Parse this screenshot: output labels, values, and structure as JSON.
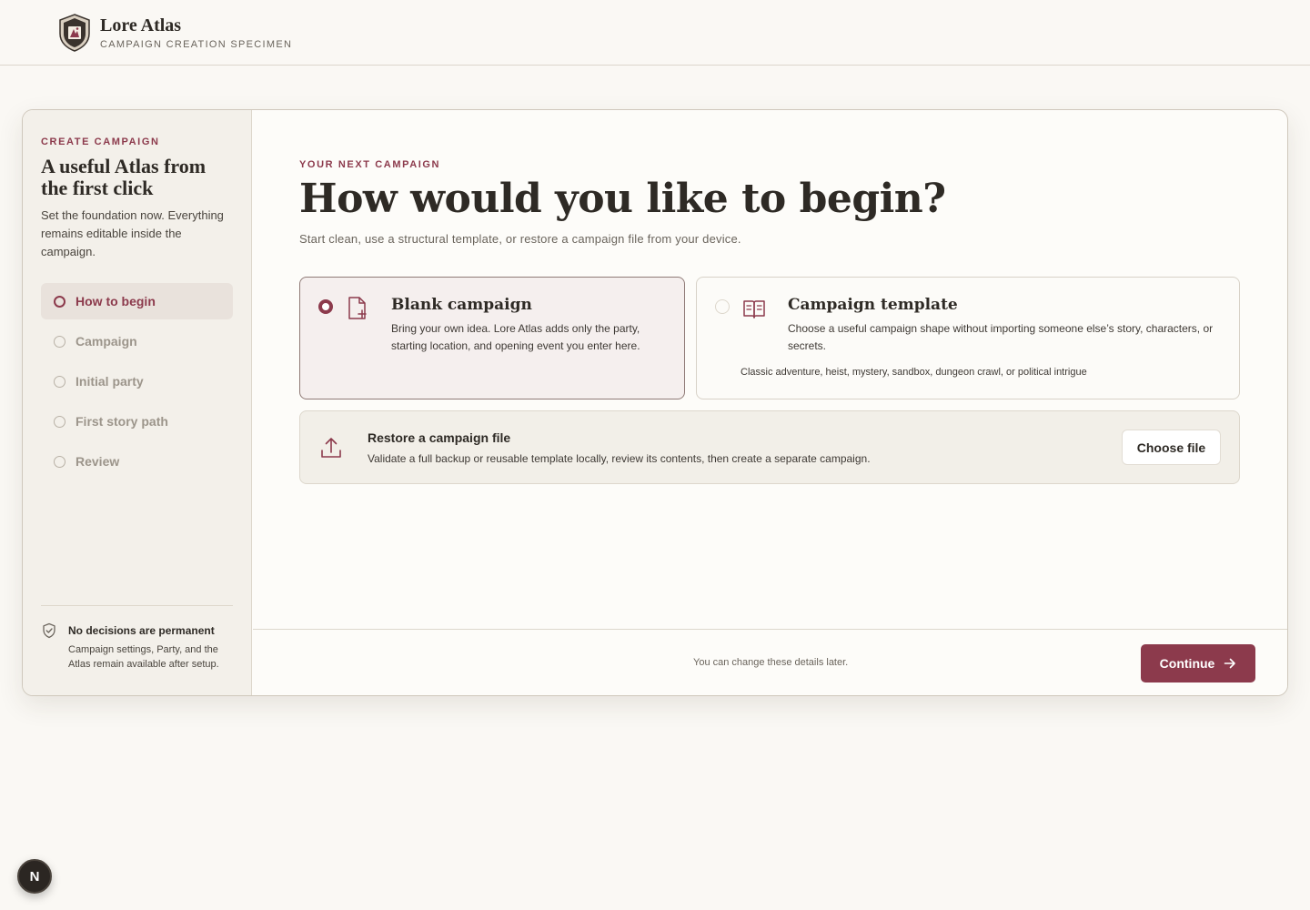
{
  "header": {
    "app_name": "Lore Atlas",
    "subtitle": "CAMPAIGN CREATION SPECIMEN",
    "logo_icon": "shield-crest-icon"
  },
  "sidebar": {
    "eyebrow": "CREATE CAMPAIGN",
    "title": "A useful Atlas from the first click",
    "description": "Set the foundation now. Everything remains editable inside the campaign.",
    "steps": [
      {
        "label": "How to begin",
        "active": true
      },
      {
        "label": "Campaign",
        "active": false
      },
      {
        "label": "Initial party",
        "active": false
      },
      {
        "label": "First story path",
        "active": false
      },
      {
        "label": "Review",
        "active": false
      }
    ],
    "note": {
      "icon": "shield-check-icon",
      "title": "No decisions are permanent",
      "body": "Campaign settings, Party, and the Atlas remain available after setup."
    }
  },
  "main": {
    "eyebrow": "YOUR NEXT CAMPAIGN",
    "title": "How would you like to begin?",
    "subtitle": "Start clean, use a structural template, or restore a campaign file from your device.",
    "options": {
      "blank": {
        "icon": "file-plus-icon",
        "title": "Blank campaign",
        "description": "Bring your own idea. Lore Atlas adds only the party, starting location, and opening event you enter here.",
        "selected": true
      },
      "template": {
        "icon": "open-book-icon",
        "title": "Campaign template",
        "description": "Choose a useful campaign shape without importing someone else’s story, characters, or secrets.",
        "tags": "Classic adventure, heist, mystery, sandbox, dungeon crawl, or political intrigue",
        "selected": false
      }
    },
    "restore": {
      "icon": "upload-icon",
      "title": "Restore a campaign file",
      "description": "Validate a full backup or reusable template locally, review its contents, then create a separate campaign.",
      "button_label": "Choose file"
    },
    "footer": {
      "note": "You can change these details later.",
      "continue_label": "Continue",
      "continue_icon": "arrow-right-icon"
    }
  },
  "badge": {
    "label": "N"
  },
  "colors": {
    "accent": "#8c3a4c",
    "background": "#faf8f4",
    "sidebar": "#f3f0ea",
    "text": "#2e2a25"
  }
}
